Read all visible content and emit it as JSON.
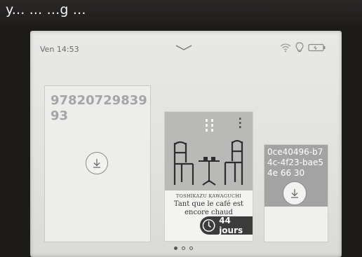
{
  "caption": "y... ... ...g ...",
  "status_bar": {
    "time": "Ven 14:53",
    "icons": [
      "chevron-down-icon",
      "wifi-icon",
      "light-bulb-icon",
      "battery-icon"
    ]
  },
  "tiles": [
    {
      "kind": "missing-cover",
      "title_text": "9782072983993",
      "action_icon": "download-icon"
    },
    {
      "kind": "book",
      "author": "TOSHIKAZU KAWAGUCHI",
      "title": "Tant que le café est encore chaud",
      "loan_badge": "44 jours",
      "badge_icon": "clock-icon"
    },
    {
      "kind": "missing-cover",
      "title_text": "0ce40496-b74c-4f23-bae5 4e 66 30",
      "action_icon": "download-icon"
    }
  ],
  "pager": {
    "pages": 3,
    "current": 1
  },
  "colors": {
    "screen": "#e4e4e1",
    "badge": "#3b3b3b",
    "placeholder_cover": "#a3a3a3"
  }
}
